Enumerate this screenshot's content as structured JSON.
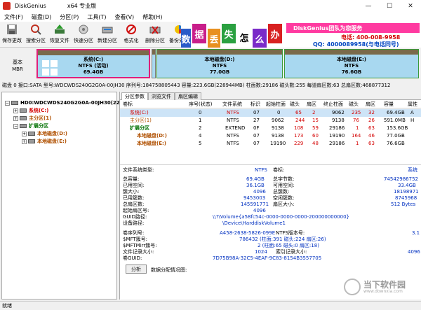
{
  "window": {
    "title": "DiskGenius",
    "edition": "x64 专业版",
    "controls": [
      "—",
      "☐",
      "✕"
    ]
  },
  "menu": [
    "文件(F)",
    "磁盘(D)",
    "分区(P)",
    "工具(T)",
    "查看(V)",
    "帮助(H)"
  ],
  "toolbar": [
    {
      "label": "保存更改",
      "icon": "save-icon"
    },
    {
      "label": "搜索分区",
      "icon": "search-icon"
    },
    {
      "label": "恢复文件",
      "icon": "recover-icon"
    },
    {
      "label": "快速分区",
      "icon": "quick-partition-icon"
    },
    {
      "label": "新建分区",
      "icon": "new-partition-icon"
    },
    {
      "label": "格式化",
      "icon": "format-icon"
    },
    {
      "label": "删除分区",
      "icon": "delete-icon"
    },
    {
      "label": "备份分区",
      "icon": "backup-icon"
    }
  ],
  "banner": {
    "chars": [
      "数",
      "据",
      "丢",
      "失",
      "怎",
      "么",
      "办"
    ],
    "slogan": "DiskGenius团队为您服务",
    "phone": "电话: 400-008-9958",
    "qq": "QQ: 4000089958(与电话同号)"
  },
  "diskmap": {
    "basic_label": "基本",
    "basic_sub": "MBR",
    "partitions": [
      {
        "name": "系统(C:)",
        "fs": "NTFS (活动)",
        "size": "69.4GB"
      },
      {
        "name": "本地磁盘(D:)",
        "fs": "NTFS",
        "size": "77.0GB"
      },
      {
        "name": "本地磁盘(E:)",
        "fs": "NTFS",
        "size": "76.6GB"
      }
    ]
  },
  "diskinfo": "磁盘 0 接口:SATA  型号:WDCWDS240G2G0A-00JH30  序列号:184758805443  容量:223.6GB(228944MB)  柱面数:29186  磁头数:255  每道扇区数:63  总扇区数:468877312",
  "tree": [
    {
      "label": "HD0:WDCWDS240G2G0A-00JH30(224GB)",
      "expander": "−",
      "color": "#000"
    },
    {
      "label": "系统(C:)",
      "expander": "+",
      "color": "#d40000"
    },
    {
      "label": "主分区(1)",
      "expander": "+",
      "color": "#b05000"
    },
    {
      "label": "扩展分区",
      "expander": "−",
      "color": "#007000"
    },
    {
      "label": "本地磁盘(D:)",
      "expander": "+",
      "color": "#b05000"
    },
    {
      "label": "本地磁盘(E:)",
      "expander": "+",
      "color": "#b05000"
    }
  ],
  "tabs": [
    "分区参数",
    "浏览文件",
    "扇区编辑"
  ],
  "table": {
    "headers": [
      "卷标",
      "序号(状态)",
      "文件系统",
      "标识",
      "起始柱面",
      "磁头",
      "扇区",
      "终止柱面",
      "磁头",
      "扇区",
      "容量",
      "属性"
    ],
    "rows": [
      [
        "系统(C:)",
        "0",
        "NTFS",
        "07",
        "0",
        "65",
        "2",
        "9062",
        "235",
        "32",
        "69.4GB",
        "A"
      ],
      [
        "主分区(1)",
        "1",
        "NTFS",
        "27",
        "9062",
        "244",
        "15",
        "9138",
        "76",
        "26",
        "591.0MB",
        "H"
      ],
      [
        "扩展分区",
        "2",
        "EXTEND",
        "0F",
        "9138",
        "108",
        "59",
        "29186",
        "1",
        "63",
        "153.6GB",
        ""
      ],
      [
        "本地磁盘(D:)",
        "4",
        "NTFS",
        "07",
        "9138",
        "173",
        "60",
        "19190",
        "164",
        "46",
        "77.0GB",
        ""
      ],
      [
        "本地磁盘(E:)",
        "5",
        "NTFS",
        "07",
        "19190",
        "229",
        "48",
        "29186",
        "1",
        "63",
        "76.6GB",
        ""
      ]
    ]
  },
  "details": {
    "fs_type_label": "文件系统类型:",
    "fs_type": "NTFS",
    "volume_label": "卷标:",
    "volume": "系统",
    "left": [
      [
        "总容量:",
        "69.4GB"
      ],
      [
        "已用空间:",
        "36.1GB"
      ],
      [
        "簇大小:",
        "4096"
      ],
      [
        "已用簇数:",
        "9453003"
      ],
      [
        "总扇区数:",
        "145591771"
      ],
      [
        "起始扇区号:",
        "4096"
      ]
    ],
    "right": [
      [
        "总字节数:",
        "74542986752"
      ],
      [
        "可用空间:",
        "33.4GB"
      ],
      [
        "总簇数:",
        "18198971"
      ],
      [
        "空闲簇数:",
        "8745968"
      ],
      [
        "扇区大小:",
        "512 Bytes"
      ]
    ],
    "guid_path_label": "GUID路径:",
    "guid_path": "\\\\?\\Volume{a58fc54c-0000-0000-0000-200000000000}",
    "dev_path_label": "设备路径:",
    "dev_path": "\\Device\\HarddiskVolume1",
    "serial_label": "卷序列号:",
    "serial": "A458-2638-5826-099E",
    "ntfs_ver_label": "NTFS版本号:",
    "ntfs_ver": "3.1",
    "mft_label": "$MFT簇号:",
    "mft": "786432 (柱面:391 磁头:224 扇区:26)",
    "mftmirr_label": "$MFTMirr簇号:",
    "mftmirr": "2 (柱面:65 磁头:0 扇区:18)",
    "rec_label": "文件记录大小:",
    "rec": "1024",
    "idx_label": "索引记录大小:",
    "idx": "4096",
    "guid_label": "卷GUID:",
    "guid": "7D75B98A-32C5-4EAF-9C83-8154B3557705",
    "analyze_btn": "分析",
    "chart_label": "数据分配情况图:"
  },
  "status": "就绪",
  "watermark": {
    "title": "当下软件园",
    "sub": "www.downxia.com"
  }
}
